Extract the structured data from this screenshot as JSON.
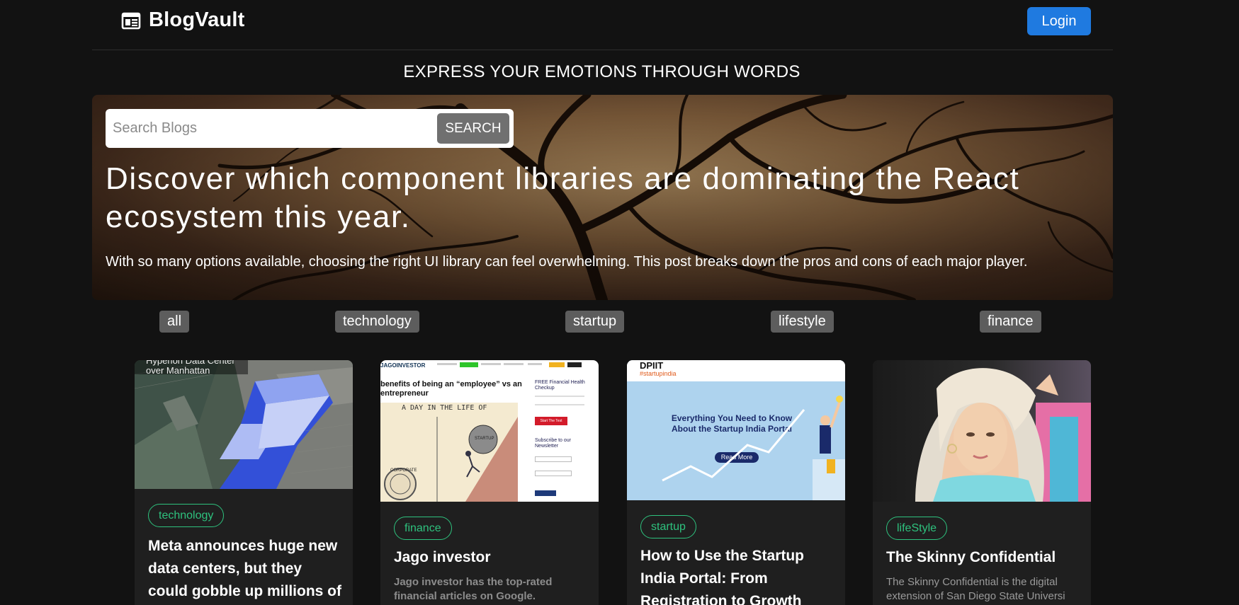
{
  "header": {
    "brand": "BlogVault",
    "login_label": "Login"
  },
  "tagline": "EXPRESS YOUR EMOTIONS THROUGH WORDS",
  "search": {
    "placeholder": "Search Blogs",
    "button_label": "SEARCH"
  },
  "hero": {
    "title": "Discover which component libraries are dominating the React ecosystem this year.",
    "description": "With so many options available, choosing the right UI library can feel overwhelming. This post breaks down the pros and cons of each major player."
  },
  "categories": [
    "all",
    "technology",
    "startup",
    "lifestyle",
    "finance"
  ],
  "cards": [
    {
      "tag": "technology",
      "title": "Meta announces huge new data centers, but they could gobble up millions of",
      "description": "",
      "image_caption": "Hyperion Data Center over Manhattan"
    },
    {
      "tag": "finance",
      "title": "Jago investor",
      "description": "Jago investor has the top-rated financial articles on Google.",
      "image_brand": "JAGOINVESTOR",
      "image_headline": "benefits of being an “employee” vs an entrepreneur",
      "image_side_title": "FREE Financial Health Checkup",
      "image_side_button": "Start The Test",
      "image_subscribe": "Subscribe to our Newsletter",
      "image_comic_caption": "A DAY IN THE LIFE OF",
      "image_comic_label_1": "STARTUP",
      "image_comic_label_2": "CORPORATE"
    },
    {
      "tag": "startup",
      "title": "How to Use the Startup India Portal: From Registration to Growth",
      "description": "",
      "image_logo_1": "DPIIT",
      "image_logo_2": "#startupindia",
      "image_headline": "Everything You Need to Know About the Startup India Portal",
      "image_button": "Read More"
    },
    {
      "tag": "lifeStyle",
      "title": "The Skinny Confidential",
      "description": "The Skinny Confidential is the digital extension of San Diego State Universi"
    }
  ]
}
